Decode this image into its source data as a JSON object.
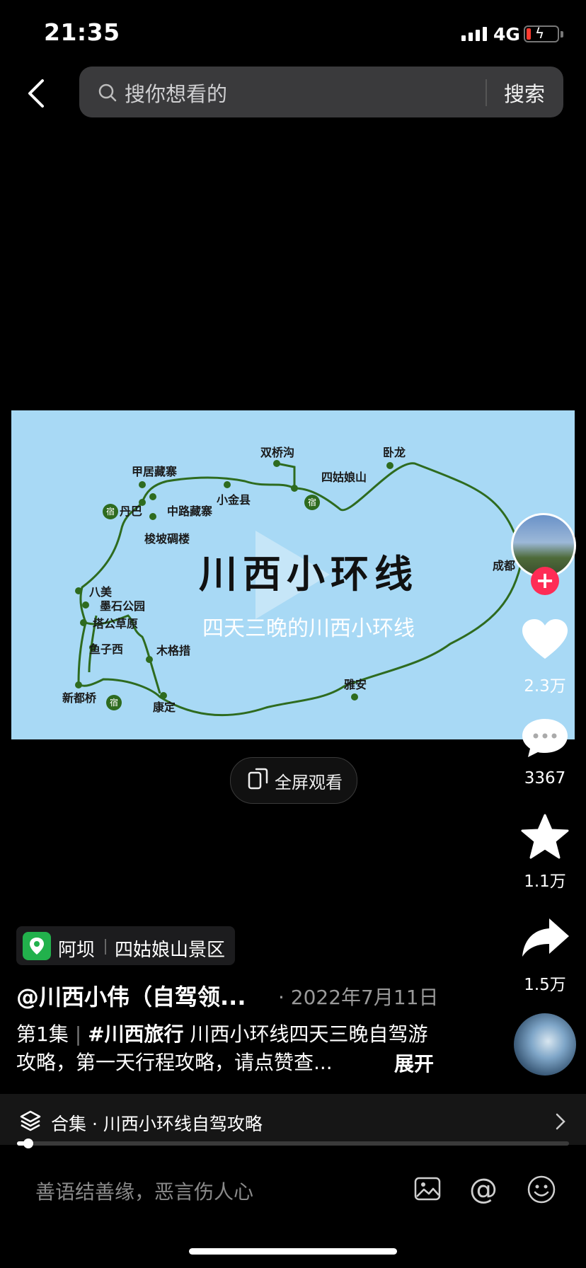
{
  "status_bar": {
    "time": "21:35",
    "network": "4G"
  },
  "search": {
    "placeholder": "搜你想看的",
    "button": "搜索"
  },
  "video": {
    "title": "川西小环线",
    "subtitle": "四天三晚的川西小环线",
    "map_labels": {
      "shuangqiaogou": "双桥沟",
      "wolong": "卧龙",
      "siguniangshan": "四姑娘山",
      "jiaju": "甲居藏寨",
      "xiaojin": "小金县",
      "danba": "丹巴",
      "zhonglu": "中路藏寨",
      "suopo": "梭坡碉楼",
      "chengdu": "成都",
      "bamei": "八美",
      "moshi": "墨石公园",
      "tagong": "塔公草原",
      "yuzixi": "鱼子西",
      "mugecuo": "木格措",
      "xinduqiao": "新都桥",
      "kangding": "康定",
      "yaan": "雅安",
      "stay_badge": "宿"
    }
  },
  "fullscreen": {
    "label": "全屏观看"
  },
  "rail": {
    "likes": "2.3万",
    "comments": "3367",
    "favorites": "1.1万",
    "shares": "1.5万"
  },
  "location": {
    "city": "阿坝",
    "place": "四姑娘山景区"
  },
  "author": "@川西小伟（自驾领...",
  "date": "· 2022年7月11日",
  "caption": {
    "episode": "第1集",
    "hashtag": "#川西旅行",
    "text": "川西小环线四天三晚自驾游攻略，第一天行程攻略，请点赞查...",
    "expand": "展开"
  },
  "collection": {
    "label": "合集 · 川西小环线自驾攻略"
  },
  "progress": {
    "fraction": 0.02
  },
  "comment_input": {
    "placeholder": "善语结善缘，恶言伤人心"
  },
  "colors": {
    "background": "#000000",
    "like_red": "#fe2c55",
    "location_green": "#22b14c",
    "route_green": "#2e6b1f",
    "map_sky": "#a8d9f5"
  },
  "icons": [
    "back-icon",
    "search-icon",
    "heart-icon",
    "comment-icon",
    "star-icon",
    "share-icon",
    "layers-icon",
    "chevron-right-icon",
    "image-icon",
    "at-icon",
    "emoji-icon",
    "location-pin-icon",
    "fullscreen-icon",
    "play-icon"
  ]
}
